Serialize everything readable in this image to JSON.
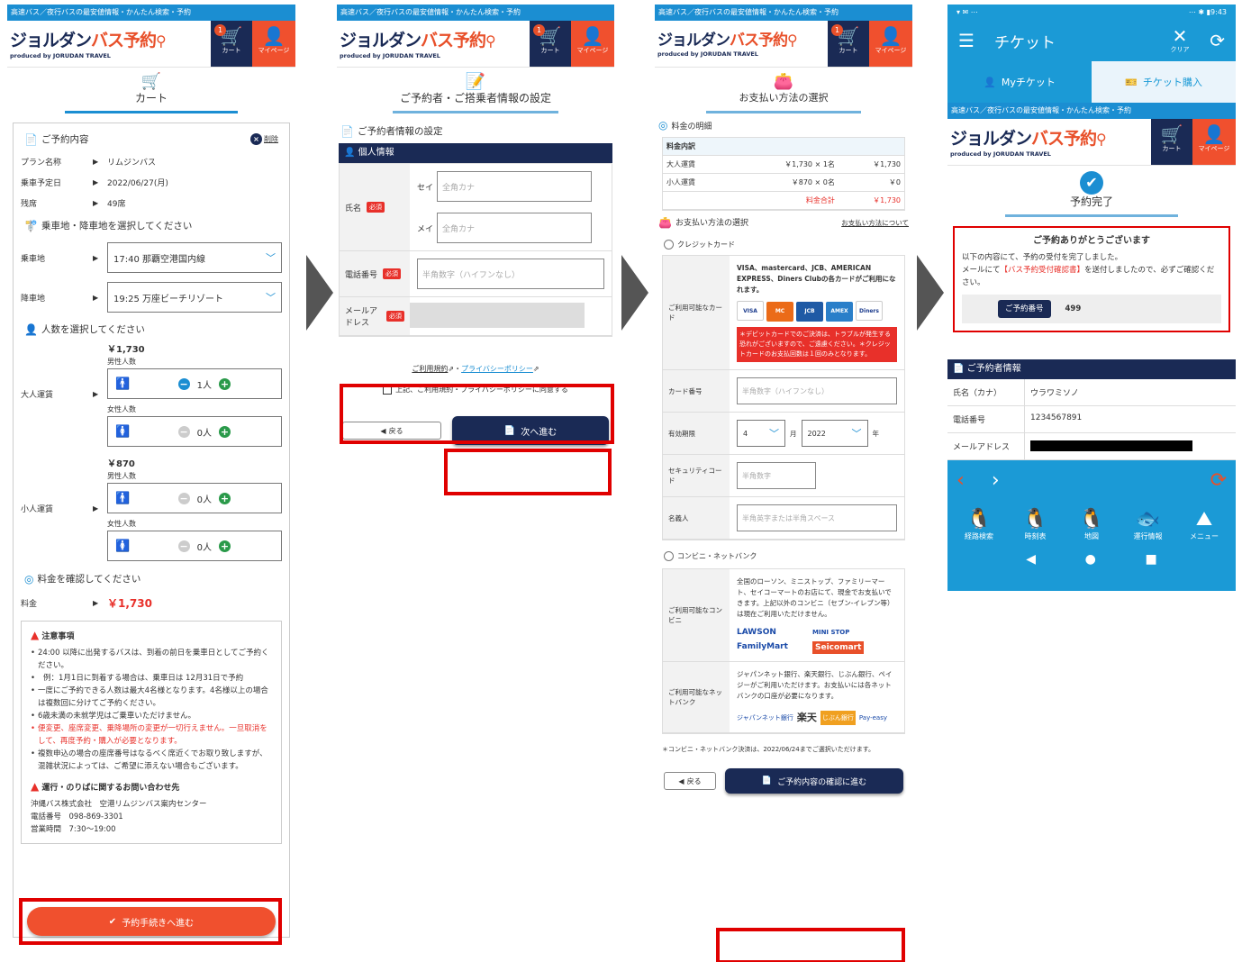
{
  "common": {
    "brand_strip": "高速バス／夜行バスの最安値情報・かんたん検索・予約",
    "logo_part1": "ジョルダン",
    "logo_part2": "バス予約",
    "logo_sub": "produced by JORUDAN TRAVEL",
    "cart_label": "カート",
    "cart_badge": "1",
    "mypage_label": "マイページ"
  },
  "icons": {
    "cart": "cart-icon",
    "user": "user-icon",
    "search": "magnifier-icon",
    "stop": "bus-stop-icon",
    "person": "person-icon",
    "yen": "coin-icon",
    "warning": "warning-icon",
    "check": "check-circle-icon",
    "doc": "document-icon",
    "menu": "hamburger-icon",
    "refresh": "refresh-icon",
    "close": "close-icon"
  },
  "colors": {
    "brand_blue": "#1b8ed2",
    "navy": "#1a2a55",
    "orange": "#f0502e",
    "red": "#e00000"
  },
  "screen1": {
    "page_title": "カート",
    "section_title": "ご予約内容",
    "delete_label": "削除",
    "rows": [
      {
        "k": "プラン名称",
        "v": "リムジンバス"
      },
      {
        "k": "乗車予定日",
        "v": "2022/06/27(月)"
      },
      {
        "k": "残席",
        "v": "49席"
      }
    ],
    "stops_title": "乗車地・降車地を選択してください",
    "board_label": "乗車地",
    "board_value": "17:40 那覇空港国内線",
    "alight_label": "降車地",
    "alight_value": "19:25 万座ビーチリゾート",
    "people_title": "人数を選択してください",
    "adult_label": "大人運賃",
    "adult_price": "￥1,730",
    "child_label": "小人運賃",
    "child_price": "￥870",
    "male_label": "男性人数",
    "female_label": "女性人数",
    "adult_male": "1人",
    "adult_female": "0人",
    "child_male": "0人",
    "child_female": "0人",
    "fare_title": "料金を確認してください",
    "fare_label": "料金",
    "fare_value": "￥1,730",
    "notice_title": "注意事項",
    "notice_items": [
      "24:00 以降に出発するバスは、到着の前日を乗車日としてご予約ください。",
      "例：1月1日に到着する場合は、乗車日は 12月31日で予約",
      "一度にご予約できる人数は最大4名様となります。4名様以上の場合は複数回に分けてご予約ください。",
      "6歳未満の未就学児はご乗車いただけません。",
      "便変更、座席変更、乗降場所の変更が一切行えません。一旦取消をして、再度予約・購入が必要となります。",
      "複数申込の場合の座席番号はなるべく席近くでお取り致しますが、混雑状況によっては、ご希望に添えない場合もございます。"
    ],
    "contact_title": "運行・のりばに関するお問い合わせ先",
    "contact_company": "沖縄バス株式会社　空港リムジンバス案内センター",
    "contact_tel": "電話番号　098-869-3301",
    "contact_hours": "営業時間　7:30〜19:00",
    "proceed_button": "予約手続きへ進む"
  },
  "screen2": {
    "page_title": "ご予約者・ご搭乗者情報の設定",
    "section_title": "ご予約者情報の設定",
    "personal_bar": "個人情報",
    "name_label": "氏名",
    "required": "必須",
    "sei_label": "セイ",
    "mei_label": "メイ",
    "kana_placeholder": "全角カナ",
    "tel_label": "電話番号",
    "tel_placeholder": "半角数字（ハイフンなし）",
    "mail_label": "メールアドレス",
    "terms_link": "ご利用規約",
    "privacy_link": "プライバシーポリシー",
    "terms_sep": "・",
    "agree_label": "上記、ご利用規約・プライバシーポリシーに同意する",
    "back_button": "戻る",
    "next_button": "次へ進む"
  },
  "screen3": {
    "page_title": "お支払い方法の選択",
    "fee_title": "料金の明細",
    "fee_header": "料金内訳",
    "fee_rows": [
      {
        "k": "大人運賃",
        "m": "￥1,730 × 1名",
        "v": "￥1,730"
      },
      {
        "k": "小人運賃",
        "m": "￥870 × 0名",
        "v": "￥0"
      }
    ],
    "total_label": "料金合計",
    "total_value": "￥1,730",
    "method_title": "お支払い方法の選択",
    "method_link": "お支払い方法について",
    "credit_label": "クレジットカード",
    "usable_card_label": "ご利用可能なカード",
    "card_desc": "VISA、mastercard、JCB、AMERICAN EXPRESS、Diners Clubの各カードがご利用になれます。",
    "card_logos": [
      "VISA",
      "MC",
      "JCB",
      "AMEX",
      "Diners"
    ],
    "card_warn": "＊デビットカードでのご決済は、トラブルが発生する恐れがございますので、ご遠慮ください。＊クレジットカードのお支払回数は１回のみとなります。",
    "card_no_label": "カード番号",
    "card_no_placeholder": "半角数字（ハイフンなし）",
    "expiry_label": "有効期限",
    "expiry_month": "4",
    "month_unit": "月",
    "expiry_year": "2022",
    "year_unit": "年",
    "cvc_label": "セキュリティコード",
    "cvc_placeholder": "半角数字",
    "holder_label": "名義人",
    "holder_placeholder": "半角英字または半角スペース",
    "conv_label": "コンビニ・ネットバンク",
    "usable_conv_label": "ご利用可能なコンビニ",
    "conv_desc": "全国のローソン、ミニストップ、ファミリーマート、セイコーマートのお店にて、現金でお支払いできます。上記以外のコンビニ（セブン-イレブン等）は現在ご利用いただけません。",
    "conv_logos": [
      "LAWSON",
      "MINI STOP",
      "FamilyMart",
      "Seicomart"
    ],
    "usable_bank_label": "ご利用可能なネットバンク",
    "bank_desc": "ジャパンネット銀行、楽天銀行、じぶん銀行、ペイジーがご利用いただけます。お支払いには各ネットバンクの口座が必要になります。",
    "bank_logos": [
      "ジャパンネット銀行",
      "楽天",
      "じぶん銀行",
      "Pay-easy"
    ],
    "deadline_note": "＊コンビニ・ネットバンク決済は、2022/06/24までご選択いただけます。",
    "back_button": "戻る",
    "confirm_button": "ご予約内容の確認に進む"
  },
  "screen4": {
    "status_left": "▾ ✉ ⋯",
    "status_right": "⋯ ✱ ▮9:43",
    "app_title": "チケット",
    "clear_label": "クリア",
    "tab_my": "Myチケット",
    "tab_buy": "チケット購入",
    "page_title": "予約完了",
    "thanks_title": "ご予約ありがとうございます",
    "thanks_body1": "以下の内容にて、予約の受付を完了しました。",
    "thanks_body2a": "メールにて",
    "thanks_body2b": "【バス予約受付確認書】",
    "thanks_body2c": "を送付しましたので、必ずご確認ください。",
    "resv_no_label": "ご予約番号",
    "resv_no": "499",
    "info_bar": "ご予約者情報",
    "info_rows": [
      {
        "k": "氏名（カナ）",
        "v": "ウラワミソノ"
      },
      {
        "k": "電話番号",
        "v": "1234567891"
      },
      {
        "k": "メールアドレス",
        "v": ""
      }
    ],
    "nav_items": [
      "経路検索",
      "時刻表",
      "地図",
      "運行情報",
      "メニュー"
    ]
  }
}
